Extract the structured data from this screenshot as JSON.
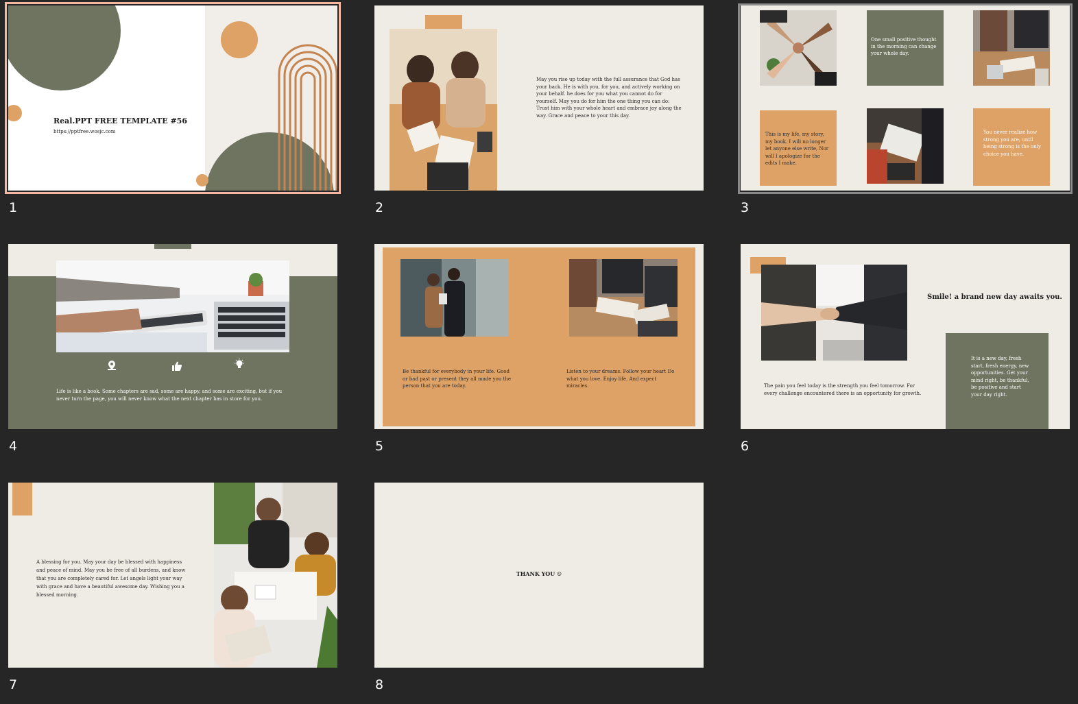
{
  "colors": {
    "olive": "#6f7460",
    "tan": "#dea166",
    "cream": "#efebe5",
    "background": "#262626",
    "selection": "#f3b7a2"
  },
  "slides": [
    {
      "number": "1",
      "title": "Real.PPT FREE TEMPLATE #56",
      "url": "https://pptfree.wosjc.com"
    },
    {
      "number": "2",
      "body": "May you rise up today with the full assurance that God has your back. He is with you, for you, and actively working on your behalf. he does for you what you cannot do for yourself. May you do for him the one thing you can do: Trust him with your whole heart and embrace joy along the way. Grace and peace to your this day."
    },
    {
      "number": "3",
      "box1": "One small positive thought in the morning can change your whole day.",
      "box2": "This is my life, my story, my book. I will no longer let anyone else write, Nor will I apologize for the edits I make.",
      "box3": "You never realize how strong you are, until being strong is the only choice you have."
    },
    {
      "number": "4",
      "body": "Life is like a book. Some chapters are sad, some are happy, and some are exciting, but if you never turn the page, you will never know what the next chapter has in store for you.",
      "icons": [
        "location-pin-icon",
        "thumbs-up-icon",
        "lightbulb-icon"
      ]
    },
    {
      "number": "5",
      "left": "Be thankful for everybody in your life. Good or bad past or present they all made you the person that you are today.",
      "right": "Listen to your dreams. Follow your heart Do what you love. Enjoy life. And expect miracles."
    },
    {
      "number": "6",
      "heading": "Smile! a brand new day awaits you.",
      "body": "The pain you feel today is the strength you feel tomorrow. For every challenge encountered there is an opportunity for growth.",
      "box": "It is a new day, fresh start, fresh energy, new opportunities. Get your mind right, be thankful, be positive and start your day right."
    },
    {
      "number": "7",
      "body": "A blessing for you. May your day be blessed with happiness and peace of mind. May you be free of all burdens, and know that you are completely cared for. Let angels light your way with grace and have a beautiful awesome day. Wishing you a blessed morning."
    },
    {
      "number": "8",
      "body": "THANK YOU ☺"
    }
  ]
}
